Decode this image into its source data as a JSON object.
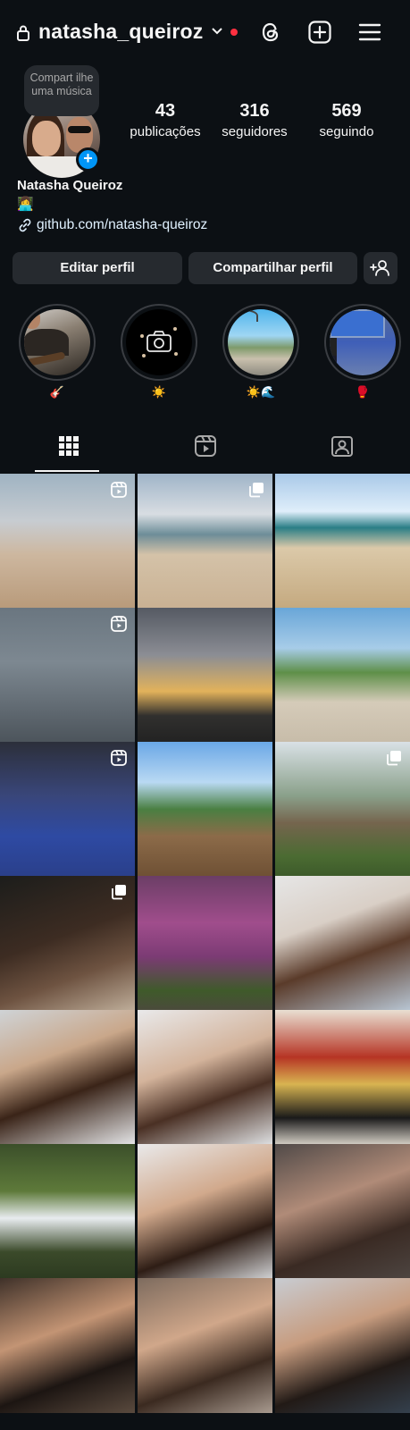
{
  "header": {
    "username": "natasha_queiroz",
    "icons": [
      "lock-icon",
      "chevron-down-icon",
      "threads-icon",
      "create-icon",
      "menu-icon"
    ]
  },
  "profile": {
    "note": "Compart ilhe uma música",
    "stats": [
      {
        "value": "43",
        "label": "publicações"
      },
      {
        "value": "316",
        "label": "seguidores"
      },
      {
        "value": "569",
        "label": "seguindo"
      }
    ],
    "full_name": "Natasha Queiroz",
    "bio_emoji": "👩‍💻",
    "link": "github.com/natasha-queiroz"
  },
  "buttons": {
    "edit": "Editar perfil",
    "share": "Compartilhar perfil"
  },
  "highlights": [
    {
      "label": "🎸"
    },
    {
      "label": "☀️"
    },
    {
      "label": "☀️🌊"
    },
    {
      "label": "🥊"
    }
  ],
  "tabs": [
    "grid-tab",
    "reels-tab",
    "tagged-tab"
  ],
  "grid": {
    "posts": [
      {
        "bg": "linear-gradient(180deg,#9fb3c2 0%,#c7ccd1 35%,#cdb79f 60%,#b89a7a 100%)",
        "badge": "reel"
      },
      {
        "bg": "linear-gradient(180deg,#9fb4c8 0%,#d8dde2 30%,#6d8d98 45%,#d4c2a8 60%,#c9b193 100%)",
        "badge": "multi"
      },
      {
        "bg": "linear-gradient(180deg,#a9c9e8 0%,#dfeefa 28%,#2a7e86 40%,#dbc9a9 55%,#c4a97f 100%)",
        "badge": ""
      },
      {
        "bg": "linear-gradient(180deg,#6a7680 0%,#7d8891 40%,#4c545b 100%)",
        "badge": "reel"
      },
      {
        "bg": "linear-gradient(180deg,#555a63 0%,#8b8d94 35%,#e2b25b 62%,#31302e 80%,#222 100%)",
        "badge": ""
      },
      {
        "bg": "linear-gradient(180deg,#69a6d8 0%,#a7cce8 30%,#5e8f48 48%,#d5cbb9 70%,#c7bca9 100%)",
        "badge": ""
      },
      {
        "bg": "linear-gradient(180deg,#2c2f3a 0%,#39467a 40%,#2e4aa3 70%,#2a3f8a 100%)",
        "badge": "reel"
      },
      {
        "bg": "linear-gradient(180deg,#6aa7e6 0%,#b9d9f3 30%,#4a7f42 50%,#8c6b49 70%,#6e5034 100%)",
        "badge": ""
      },
      {
        "bg": "linear-gradient(180deg,#d9e1e6 0%,#8aa08a 40%,#75654e 60%,#4b6b32 85%,#3c5a2a 100%)",
        "badge": "multi"
      },
      {
        "bg": "linear-gradient(160deg,#1c1d1b 0%,#3d2c22 45%,#6e5341 70%,#bfae9a 100%)",
        "badge": "multi"
      },
      {
        "bg": "linear-gradient(180deg,#6b3e66 0%,#a04d8c 35%,#7b3b74 60%,#3f5a2a 85%,#4b4a3c 100%)",
        "badge": ""
      },
      {
        "bg": "linear-gradient(160deg,#e6e6e6 0%,#d9cfc6 35%,#5a3b2a 60%,#b8c6d4 100%)",
        "badge": ""
      },
      {
        "bg": "linear-gradient(160deg,#cfd3d6 0%,#c9a78a 35%,#3a2418 60%,#e5e6e8 100%)",
        "badge": ""
      },
      {
        "bg": "linear-gradient(160deg,#e9e9ea 0%,#d3b39b 40%,#4a3024 65%,#dfe1e3 100%)",
        "badge": ""
      },
      {
        "bg": "linear-gradient(180deg,#e9dfd2 0%,#b63424 35%,#d8b451 55%,#1a1a1a 80%,#d6d0c6 100%)",
        "badge": ""
      },
      {
        "bg": "linear-gradient(180deg,#3b4f2a 0%,#5e7a3a 35%,#e8ecef 55%,#3b4a2a 80%,#2c3a20 100%)",
        "badge": ""
      },
      {
        "bg": "linear-gradient(160deg,#e9e9ea 0%,#d1a98c 40%,#2e1d15 70%,#d2d3d5 100%)",
        "badge": ""
      },
      {
        "bg": "linear-gradient(160deg,#514a48 0%,#b08b78 40%,#3a2a23 70%,#4d4541 100%)",
        "badge": ""
      },
      {
        "bg": "linear-gradient(160deg,#3f3129 0%,#c39474 40%,#1c1512 70%,#5a4a3e 100%)",
        "badge": ""
      },
      {
        "bg": "linear-gradient(160deg,#7d6b5e 0%,#d0a78a 40%,#3b2a20 70%,#a89a8f 100%)",
        "badge": ""
      },
      {
        "bg": "linear-gradient(160deg,#c8ccd2 0%,#c79c7f 40%,#221a16 70%,#34404d 100%)",
        "badge": ""
      }
    ]
  },
  "colors": {
    "background": "#0c1014",
    "button": "#262a2f",
    "accent_blue": "#0095f6",
    "notification_red": "#ff3040"
  }
}
